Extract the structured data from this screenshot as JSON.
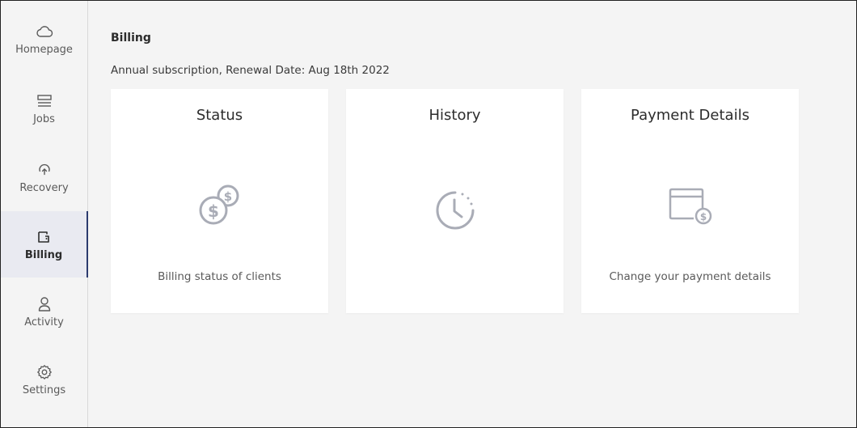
{
  "sidebar": {
    "items": [
      {
        "label": "Homepage",
        "icon": "cloud-icon"
      },
      {
        "label": "Jobs",
        "icon": "jobs-icon"
      },
      {
        "label": "Recovery",
        "icon": "recovery-icon"
      },
      {
        "label": "Billing",
        "icon": "wallet-icon",
        "active": true
      },
      {
        "label": "Activity",
        "icon": "user-icon"
      },
      {
        "label": "Settings",
        "icon": "gear-icon"
      }
    ]
  },
  "main": {
    "title": "Billing",
    "subtitle": "Annual subscription, Renewal Date: Aug 18th 2022",
    "cards": [
      {
        "title": "Status",
        "description": "Billing status of clients",
        "icon": "coins-icon"
      },
      {
        "title": "History",
        "description": "",
        "icon": "history-clock-icon"
      },
      {
        "title": "Payment Details",
        "description": "Change your payment details",
        "icon": "credit-card-icon"
      }
    ]
  },
  "colors": {
    "background": "#f4f4f4",
    "card": "#ffffff",
    "active_nav_bg": "#e9eaf1",
    "active_nav_border": "#2b3a6e",
    "icon_gray": "#a9acb6"
  }
}
